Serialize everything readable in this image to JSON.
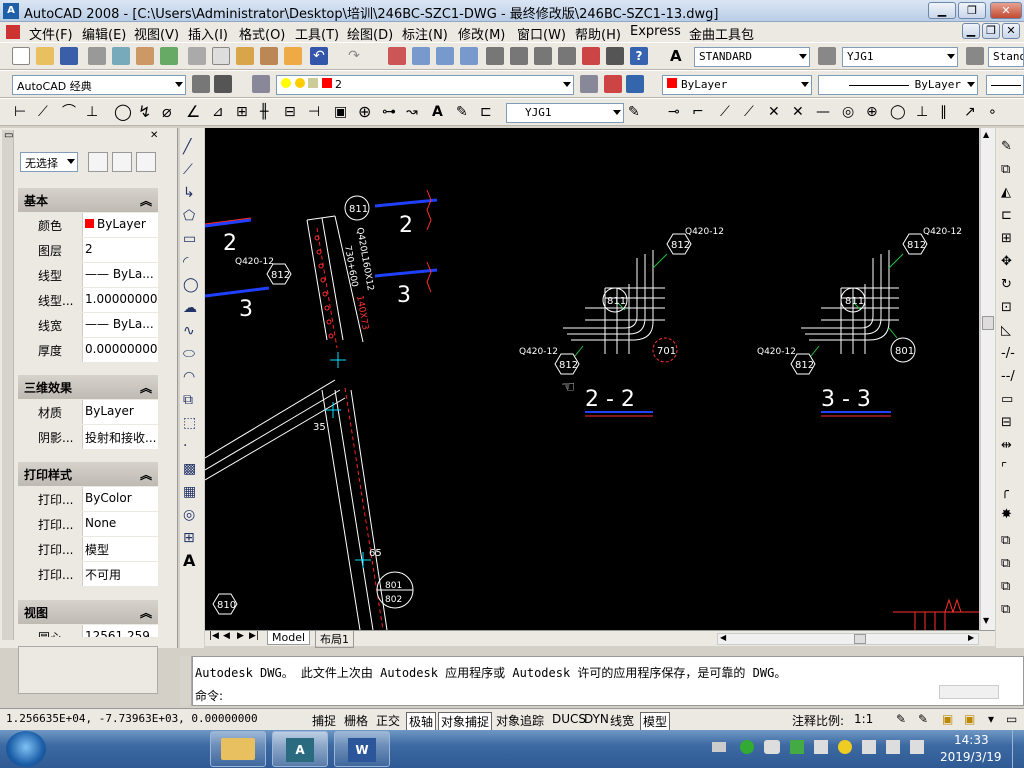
{
  "window": {
    "title": "AutoCAD 2008 - [C:\\Users\\Administrator\\Desktop\\培训\\246BC-SZC1-DWG - 最终修改版\\246BC-SZC1-13.dwg]"
  },
  "menu": [
    "文件(F)",
    "编辑(E)",
    "视图(V)",
    "插入(I)",
    "格式(O)",
    "工具(T)",
    "绘图(D)",
    "标注(N)",
    "修改(M)",
    "窗口(W)",
    "帮助(H)",
    "Express",
    "金曲工具包"
  ],
  "toolbar": {
    "text_style": "STANDARD",
    "dim_style": "YJG1",
    "table_style": "Stand",
    "workspace": "AutoCAD 经典",
    "layer": "2",
    "color": "ByLayer",
    "linetype": "ByLayer",
    "dim_style2": "YJG1"
  },
  "properties": {
    "selection": "无选择",
    "sections": [
      {
        "title": "基本",
        "rows": [
          {
            "k": "颜色",
            "v": "ByLayer"
          },
          {
            "k": "图层",
            "v": "2"
          },
          {
            "k": "线型",
            "v": "—— ByLa..."
          },
          {
            "k": "线型...",
            "v": "1.00000000"
          },
          {
            "k": "线宽",
            "v": "—— ByLa..."
          },
          {
            "k": "厚度",
            "v": "0.00000000"
          }
        ]
      },
      {
        "title": "三维效果",
        "rows": [
          {
            "k": "材质",
            "v": "ByLayer"
          },
          {
            "k": "阴影...",
            "v": "投射和接收..."
          }
        ]
      },
      {
        "title": "打印样式",
        "rows": [
          {
            "k": "打印...",
            "v": "ByColor"
          },
          {
            "k": "打印...",
            "v": "None"
          },
          {
            "k": "打印...",
            "v": "模型"
          },
          {
            "k": "打印...",
            "v": "不可用"
          }
        ]
      },
      {
        "title": "视图",
        "rows": [
          {
            "k": "圆心...",
            "v": "12561.259"
          }
        ]
      }
    ]
  },
  "drawing": {
    "labels": {
      "sec2": "2",
      "sec3": "3",
      "sec2b": "2",
      "sec3b": "3",
      "b811": "811",
      "b812": "812",
      "b810": "810",
      "b801": "801",
      "b802": "802",
      "b701": "701",
      "q1": "Q420-12",
      "q2": "Q420-12",
      "q3": "Q420-12",
      "q4": "Q420-12",
      "q5": "Q420-12",
      "vert1": "Q420L160X12",
      "vert2": "730+600",
      "vert3": "140X73",
      "dim35": "35",
      "dim65": "65",
      "title22": "2 - 2",
      "title33": "3 - 3"
    }
  },
  "tabs": {
    "model": "Model",
    "layout": "布局1"
  },
  "command": {
    "line1": "Autodesk DWG。  此文件上次由 Autodesk 应用程序或 Autodesk 许可的应用程序保存，是可靠的 DWG。",
    "prompt": "命令:"
  },
  "status": {
    "coords": "1.256635E+04, -7.73963E+03, 0.00000000",
    "toggles": [
      "捕捉",
      "栅格",
      "正交",
      "极轴",
      "对象捕捉",
      "对象追踪",
      "DUCS",
      "DYN",
      "线宽",
      "模型"
    ],
    "anno_scale_label": "注释比例:",
    "anno_scale": "1:1"
  },
  "taskbar": {
    "time": "14:33",
    "date": "2019/3/19"
  },
  "colors": {
    "canvas": "#000000",
    "red": "#ff0000",
    "blue": "#0000ff",
    "white": "#ffffff"
  }
}
